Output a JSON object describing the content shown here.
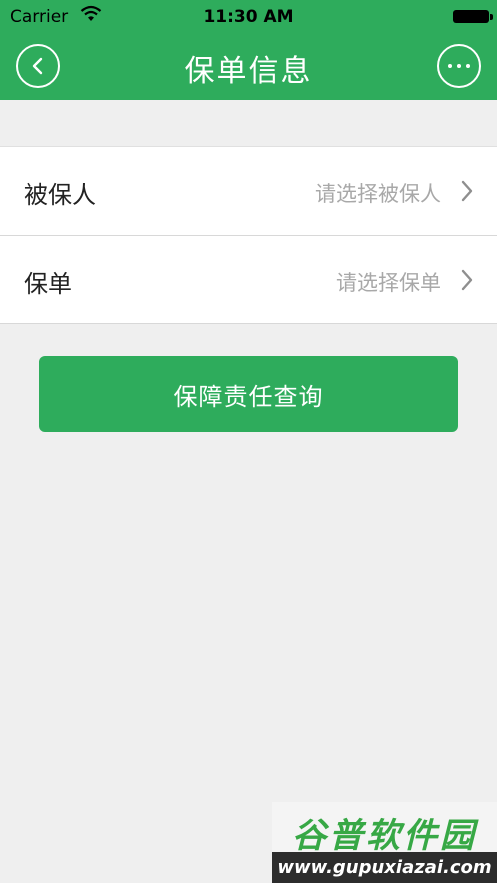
{
  "status_bar": {
    "carrier": "Carrier",
    "time": "11:30 AM"
  },
  "nav": {
    "title": "保单信息",
    "more_icon": "more-dots-icon",
    "back_icon": "back-arrow-icon"
  },
  "form": {
    "rows": [
      {
        "label": "被保人",
        "placeholder": "请选择被保人"
      },
      {
        "label": "保单",
        "placeholder": "请选择保单"
      }
    ]
  },
  "action": {
    "button_label": "保障责任查询"
  },
  "watermark": {
    "title": "谷普软件园",
    "url": "www.gupuxiazai.com"
  },
  "colors": {
    "primary": "#2eac5c",
    "background": "#efefef",
    "placeholder": "#a8a8a8"
  }
}
